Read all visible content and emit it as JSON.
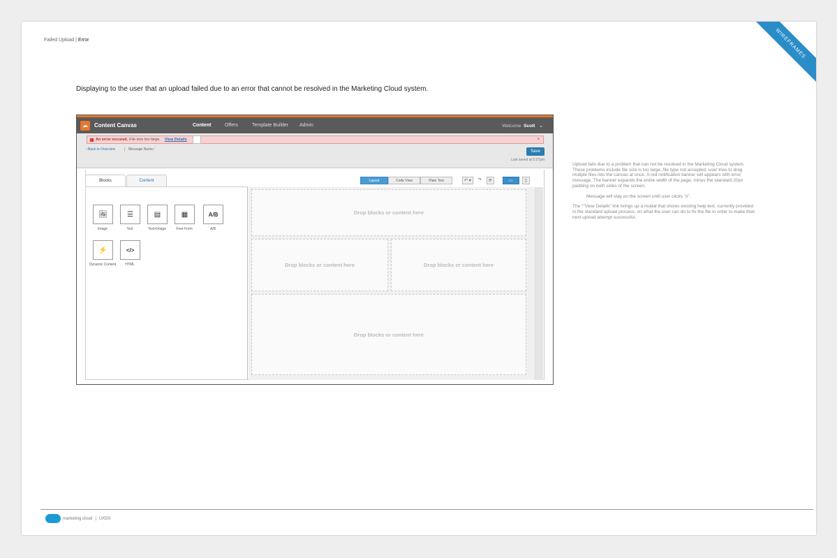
{
  "page": {
    "breadcrumb_label": "Failed Upload",
    "breadcrumb_current": "Error",
    "ribbon": "WIREFRAMES",
    "description": "Displaying to the user that an upload failed due to an error that cannot be resolved in the Marketing Cloud system."
  },
  "app": {
    "logo_glyph": "☁",
    "title": "Content Canvas",
    "nav": [
      "Content",
      "Offers",
      "Template Builder",
      "Admin"
    ],
    "welcome_label": "Welcome",
    "user_name": "Scott",
    "chevron": "⌄"
  },
  "error_banner": {
    "icon": "!",
    "title": "An error occured.",
    "message": "File size too large.",
    "link": "View Details",
    "close": "×"
  },
  "toolbar": {
    "back_link": "‹ Back to Overview",
    "message_name": "Message Name  ⁄",
    "save_label": "Save",
    "last_saved": "Last saved at 5:27pm"
  },
  "tabs": [
    "Blocks",
    "Content"
  ],
  "blocks": [
    {
      "icon": "image-icon",
      "glyph": "🖼",
      "label": "Image"
    },
    {
      "icon": "text-icon",
      "glyph": "☰",
      "label": "Text"
    },
    {
      "icon": "text-image-icon",
      "glyph": "▤",
      "label": "Text+Image"
    },
    {
      "icon": "free-form-icon",
      "glyph": "▦",
      "label": "Free Form"
    },
    {
      "icon": "ab-icon",
      "glyph": "A/B",
      "label": "A/B"
    },
    {
      "icon": "dynamic-content-icon",
      "glyph": "⚡",
      "label": "Dynamic Content"
    },
    {
      "icon": "html-icon",
      "glyph": "</>",
      "label": "HTML"
    }
  ],
  "view_buttons": [
    "Layout",
    "Code View",
    "Plain Text"
  ],
  "tools": {
    "undo": "↶ ▾",
    "redo": "↷",
    "refresh": "⟳",
    "desktop": "▭",
    "mobile": "▯"
  },
  "dropzone_text": "Drop blocks or content here",
  "notes": [
    "Upload fails due to a problem that can not be resolved in the Marketing Cloud system. These problems include file size is too large, file type not accepted, user tries to drag mutiple files into the canvas at once. A red notification banner will appears with error message. The banner expands the entire width of the page, minus the standard 20px padding on both sides of the screen.",
    "Message will stay on the screen until user clicks \"x\".",
    "The \"\"View Details\" link brings up a modal that shows existing help text, currently provided in the standard upload process, on what the user can do to fix the file in order to make their next upload attempt successful."
  ],
  "footer": {
    "brand": "marketing cloud",
    "section": "UXDS"
  }
}
